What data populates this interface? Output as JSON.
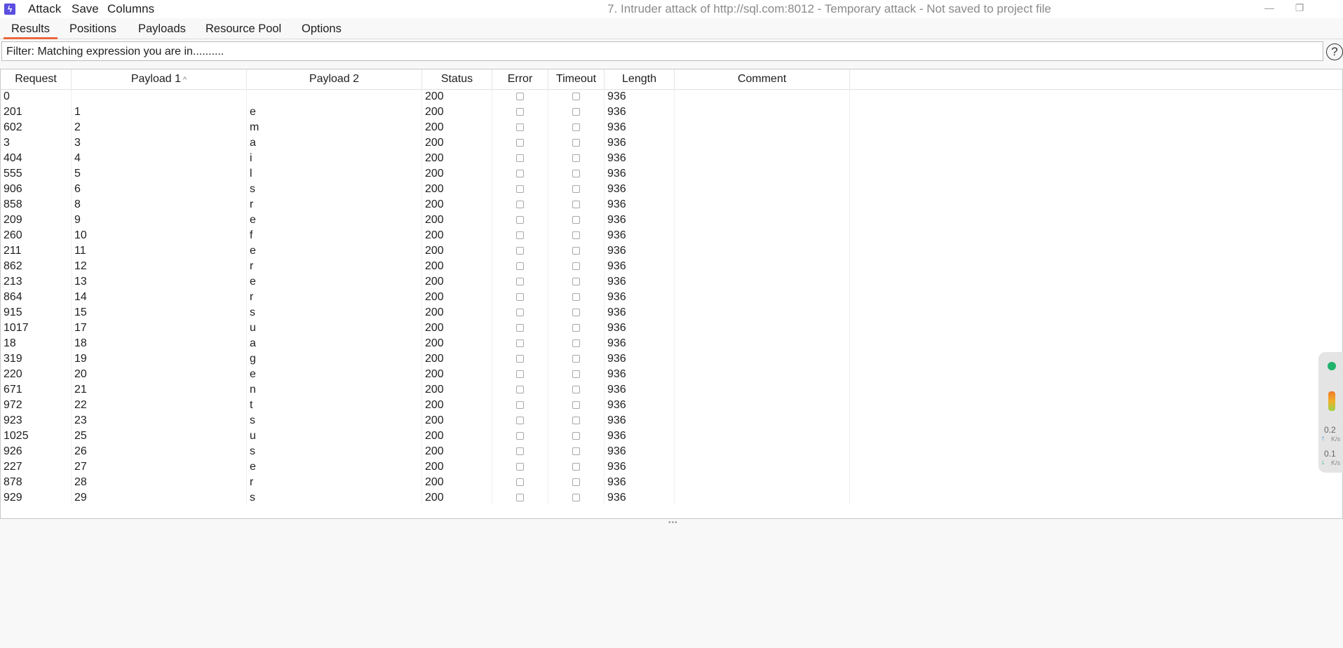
{
  "window": {
    "title": "7. Intruder attack of http://sql.com:8012 - Temporary attack - Not saved to project file",
    "menu": [
      "Attack",
      "Save",
      "Columns"
    ],
    "controls": {
      "minimize": "—",
      "restore": "❐",
      "close": ""
    }
  },
  "tabs": [
    "Results",
    "Positions",
    "Payloads",
    "Resource Pool",
    "Options"
  ],
  "active_tab": "Results",
  "filter": {
    "text": "Filter: Matching expression you are in..........",
    "help": "?"
  },
  "table": {
    "headers": [
      "Request",
      "Payload 1",
      "Payload 2",
      "Status",
      "Error",
      "Timeout",
      "Length",
      "Comment"
    ],
    "sort_column": "Payload 1",
    "sort_icon": "^",
    "rows": [
      {
        "request": "0",
        "payload1": "",
        "payload2": "",
        "status": "200",
        "length": "936"
      },
      {
        "request": "201",
        "payload1": "1",
        "payload2": "e",
        "status": "200",
        "length": "936"
      },
      {
        "request": "602",
        "payload1": "2",
        "payload2": "m",
        "status": "200",
        "length": "936"
      },
      {
        "request": "3",
        "payload1": "3",
        "payload2": "a",
        "status": "200",
        "length": "936"
      },
      {
        "request": "404",
        "payload1": "4",
        "payload2": "i",
        "status": "200",
        "length": "936"
      },
      {
        "request": "555",
        "payload1": "5",
        "payload2": "l",
        "status": "200",
        "length": "936"
      },
      {
        "request": "906",
        "payload1": "6",
        "payload2": "s",
        "status": "200",
        "length": "936"
      },
      {
        "request": "858",
        "payload1": "8",
        "payload2": "r",
        "status": "200",
        "length": "936"
      },
      {
        "request": "209",
        "payload1": "9",
        "payload2": "e",
        "status": "200",
        "length": "936"
      },
      {
        "request": "260",
        "payload1": "10",
        "payload2": "f",
        "status": "200",
        "length": "936"
      },
      {
        "request": "211",
        "payload1": "11",
        "payload2": "e",
        "status": "200",
        "length": "936"
      },
      {
        "request": "862",
        "payload1": "12",
        "payload2": "r",
        "status": "200",
        "length": "936"
      },
      {
        "request": "213",
        "payload1": "13",
        "payload2": "e",
        "status": "200",
        "length": "936"
      },
      {
        "request": "864",
        "payload1": "14",
        "payload2": "r",
        "status": "200",
        "length": "936"
      },
      {
        "request": "915",
        "payload1": "15",
        "payload2": "s",
        "status": "200",
        "length": "936"
      },
      {
        "request": "1017",
        "payload1": "17",
        "payload2": "u",
        "status": "200",
        "length": "936"
      },
      {
        "request": "18",
        "payload1": "18",
        "payload2": "a",
        "status": "200",
        "length": "936"
      },
      {
        "request": "319",
        "payload1": "19",
        "payload2": "g",
        "status": "200",
        "length": "936"
      },
      {
        "request": "220",
        "payload1": "20",
        "payload2": "e",
        "status": "200",
        "length": "936"
      },
      {
        "request": "671",
        "payload1": "21",
        "payload2": "n",
        "status": "200",
        "length": "936"
      },
      {
        "request": "972",
        "payload1": "22",
        "payload2": "t",
        "status": "200",
        "length": "936"
      },
      {
        "request": "923",
        "payload1": "23",
        "payload2": "s",
        "status": "200",
        "length": "936"
      },
      {
        "request": "1025",
        "payload1": "25",
        "payload2": "u",
        "status": "200",
        "length": "936"
      },
      {
        "request": "926",
        "payload1": "26",
        "payload2": "s",
        "status": "200",
        "length": "936"
      },
      {
        "request": "227",
        "payload1": "27",
        "payload2": "e",
        "status": "200",
        "length": "936"
      },
      {
        "request": "878",
        "payload1": "28",
        "payload2": "r",
        "status": "200",
        "length": "936"
      },
      {
        "request": "929",
        "payload1": "29",
        "payload2": "s",
        "status": "200",
        "length": "936"
      }
    ]
  },
  "network_widget": {
    "upload": "0.2",
    "download": "0.1",
    "unit": "K/s",
    "colors": {
      "dot": "#1fb36b",
      "up": "#2a8ce0",
      "down": "#1fb36b"
    }
  },
  "colors": {
    "active_tab_underline": "#e8693c",
    "app_icon": "#5a4fe0"
  }
}
